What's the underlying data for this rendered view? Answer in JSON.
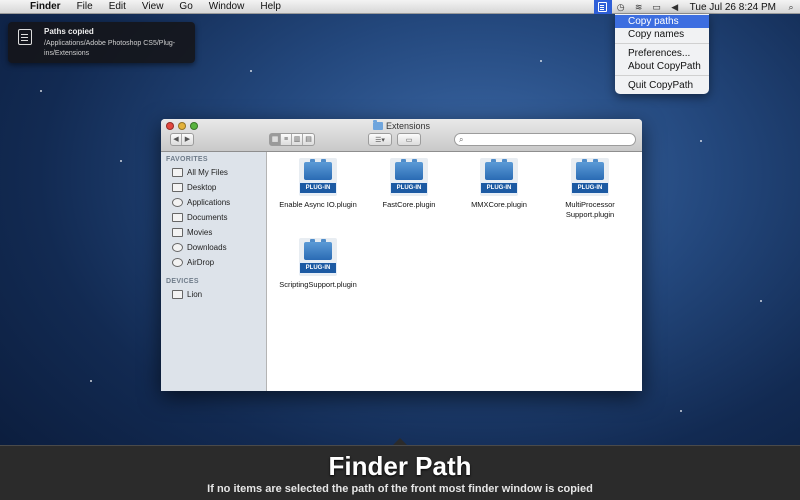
{
  "menubar": {
    "items": [
      "Finder",
      "File",
      "Edit",
      "View",
      "Go",
      "Window",
      "Help"
    ],
    "clock": "Tue Jul 26  8:24 PM"
  },
  "dropdown": {
    "items": [
      "Copy paths",
      "Copy names",
      "Preferences...",
      "About CopyPath",
      "Quit CopyPath"
    ]
  },
  "notification": {
    "title": "Paths copied",
    "body": "/Applications/Adobe Photoshop CS5/Plug-ins/Extensions"
  },
  "finder": {
    "title": "Extensions",
    "sidebar": {
      "favorites_heading": "FAVORITES",
      "favorites": [
        "All My Files",
        "Desktop",
        "Applications",
        "Documents",
        "Movies",
        "Downloads",
        "AirDrop"
      ],
      "devices_heading": "DEVICES",
      "devices": [
        "Lion"
      ]
    },
    "files": [
      {
        "name": "Enable Async IO.plugin",
        "badge": "PLUG-IN"
      },
      {
        "name": "FastCore.plugin",
        "badge": "PLUG-IN"
      },
      {
        "name": "MMXCore.plugin",
        "badge": "PLUG-IN"
      },
      {
        "name": "MultiProcessor Support.plugin",
        "badge": "PLUG-IN"
      },
      {
        "name": "ScriptingSupport.plugin",
        "badge": "PLUG-IN"
      }
    ]
  },
  "banner": {
    "title": "Finder Path",
    "subtitle": "If no items are selected the path of the front most finder window is copied"
  },
  "colors": {
    "selection": "#3d6ee0",
    "plugin_badge": "#1c5aa3"
  }
}
